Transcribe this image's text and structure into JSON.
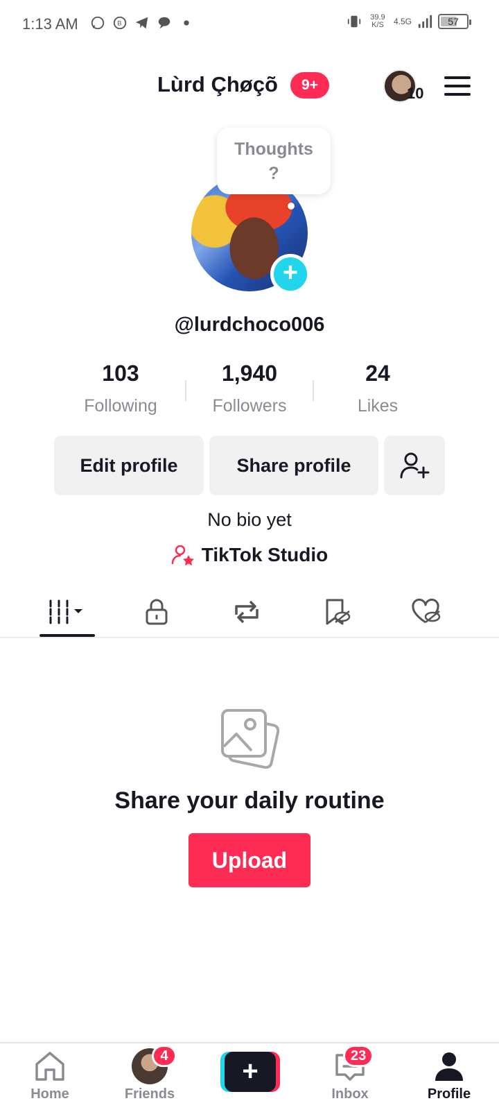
{
  "status_bar": {
    "time": "1:13 AM",
    "net_speed_value": "39.9",
    "net_speed_unit": "K/S",
    "network_type": "4.5G",
    "battery_level": "57",
    "left_icons": [
      "whatsapp-icon",
      "whatsapp-business-icon",
      "telegram-icon",
      "chat-icon",
      "dot-icon"
    ]
  },
  "header": {
    "display_name": "Lùrd Çhøçõ",
    "name_badge": "9+",
    "avatar_count": "10"
  },
  "profile": {
    "thoughts_bubble": "Thoughts\n?",
    "username": "@lurdchoco006",
    "bio": "No bio yet",
    "studio_label": "TikTok Studio"
  },
  "stats": [
    {
      "value": "103",
      "label": "Following"
    },
    {
      "value": "1,940",
      "label": "Followers"
    },
    {
      "value": "24",
      "label": "Likes"
    }
  ],
  "buttons": {
    "edit_profile": "Edit profile",
    "share_profile": "Share profile"
  },
  "tabs": [
    {
      "icon": "grid-icon",
      "active": true
    },
    {
      "icon": "lock-icon",
      "active": false
    },
    {
      "icon": "repost-icon",
      "active": false
    },
    {
      "icon": "favorites-hidden-icon",
      "active": false
    },
    {
      "icon": "liked-hidden-icon",
      "active": false
    }
  ],
  "empty_state": {
    "title": "Share your daily routine",
    "upload_label": "Upload"
  },
  "bottom_nav": {
    "home": "Home",
    "friends": "Friends",
    "friends_badge": "4",
    "inbox": "Inbox",
    "inbox_badge": "23",
    "profile": "Profile",
    "create": "+"
  },
  "colors": {
    "accent": "#fe2c55",
    "cyan": "#20d5ec",
    "text": "#161823",
    "muted": "#8a8b91"
  }
}
